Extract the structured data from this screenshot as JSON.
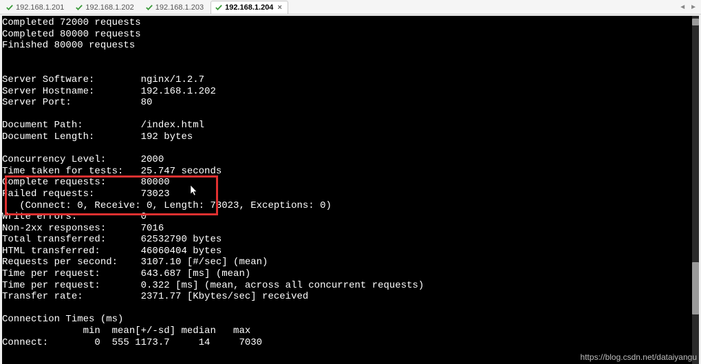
{
  "tabs": [
    {
      "label": "192.168.1.201",
      "active": false
    },
    {
      "label": "192.168.1.202",
      "active": false
    },
    {
      "label": "192.168.1.203",
      "active": false
    },
    {
      "label": "192.168.1.204",
      "active": true
    }
  ],
  "terminal": {
    "preLines": [
      "Completed 72000 requests",
      "Completed 80000 requests",
      "Finished 80000 requests",
      "",
      ""
    ],
    "fields": [
      {
        "label": "Server Software:",
        "value": "nginx/1.2.7"
      },
      {
        "label": "Server Hostname:",
        "value": "192.168.1.202"
      },
      {
        "label": "Server Port:",
        "value": "80"
      },
      {
        "label": "",
        "value": ""
      },
      {
        "label": "Document Path:",
        "value": "/index.html"
      },
      {
        "label": "Document Length:",
        "value": "192 bytes"
      },
      {
        "label": "",
        "value": ""
      },
      {
        "label": "Concurrency Level:",
        "value": "2000"
      },
      {
        "label": "Time taken for tests:",
        "value": "25.747 seconds"
      },
      {
        "label": "Complete requests:",
        "value": "80000"
      },
      {
        "label": "Failed requests:",
        "value": "73023"
      },
      {
        "label": "   (Connect: 0, Receive: 0, Length: 73023, Exceptions: 0)",
        "value": ""
      },
      {
        "label": "Write errors:",
        "value": "0"
      },
      {
        "label": "Non-2xx responses:",
        "value": "7016"
      },
      {
        "label": "Total transferred:",
        "value": "62532790 bytes"
      },
      {
        "label": "HTML transferred:",
        "value": "46060404 bytes"
      },
      {
        "label": "Requests per second:",
        "value": "3107.10 [#/sec] (mean)"
      },
      {
        "label": "Time per request:",
        "value": "643.687 [ms] (mean)"
      },
      {
        "label": "Time per request:",
        "value": "0.322 [ms] (mean, across all concurrent requests)"
      },
      {
        "label": "Transfer rate:",
        "value": "2371.77 [Kbytes/sec] received"
      },
      {
        "label": "",
        "value": ""
      },
      {
        "label": "Connection Times (ms)",
        "value": ""
      }
    ],
    "tableHeader": "              min  mean[+/-sd] median   max",
    "tableRow": {
      "name": "Connect:",
      "min": "0",
      "mean": "555",
      "sd": "1173.7",
      "median": "14",
      "max": "7030"
    }
  },
  "highlight": {
    "fields": [
      "Complete requests:",
      "Failed requests:"
    ]
  },
  "watermark": "https://blog.csdn.net/dataiyangu"
}
